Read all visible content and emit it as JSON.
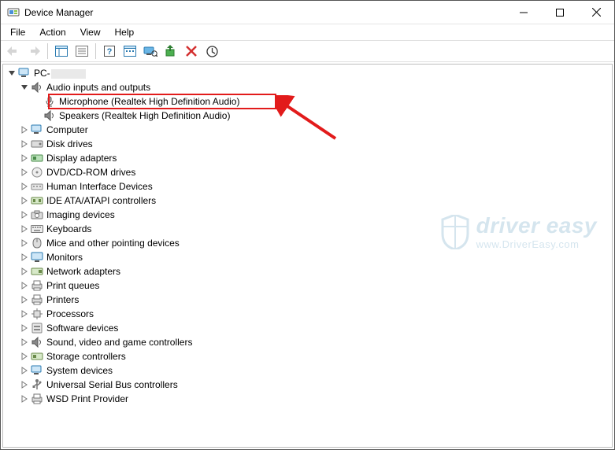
{
  "window": {
    "title": "Device Manager"
  },
  "menu": {
    "file": "File",
    "action": "Action",
    "view": "View",
    "help": "Help"
  },
  "tree": {
    "root": "PC-",
    "audio": {
      "label": "Audio inputs and outputs",
      "mic": "Microphone (Realtek High Definition Audio)",
      "spk": "Speakers (Realtek High Definition Audio)"
    },
    "computer": "Computer",
    "disk": "Disk drives",
    "display": "Display adapters",
    "dvd": "DVD/CD-ROM drives",
    "hid": "Human Interface Devices",
    "ide": "IDE ATA/ATAPI controllers",
    "imaging": "Imaging devices",
    "keyboards": "Keyboards",
    "mice": "Mice and other pointing devices",
    "monitors": "Monitors",
    "network": "Network adapters",
    "printqueues": "Print queues",
    "printers": "Printers",
    "processors": "Processors",
    "software": "Software devices",
    "sound": "Sound, video and game controllers",
    "storage": "Storage controllers",
    "system": "System devices",
    "usb": "Universal Serial Bus controllers",
    "wsd": "WSD Print Provider"
  },
  "watermark": {
    "line1": "driver easy",
    "line2": "www.DriverEasy.com"
  }
}
